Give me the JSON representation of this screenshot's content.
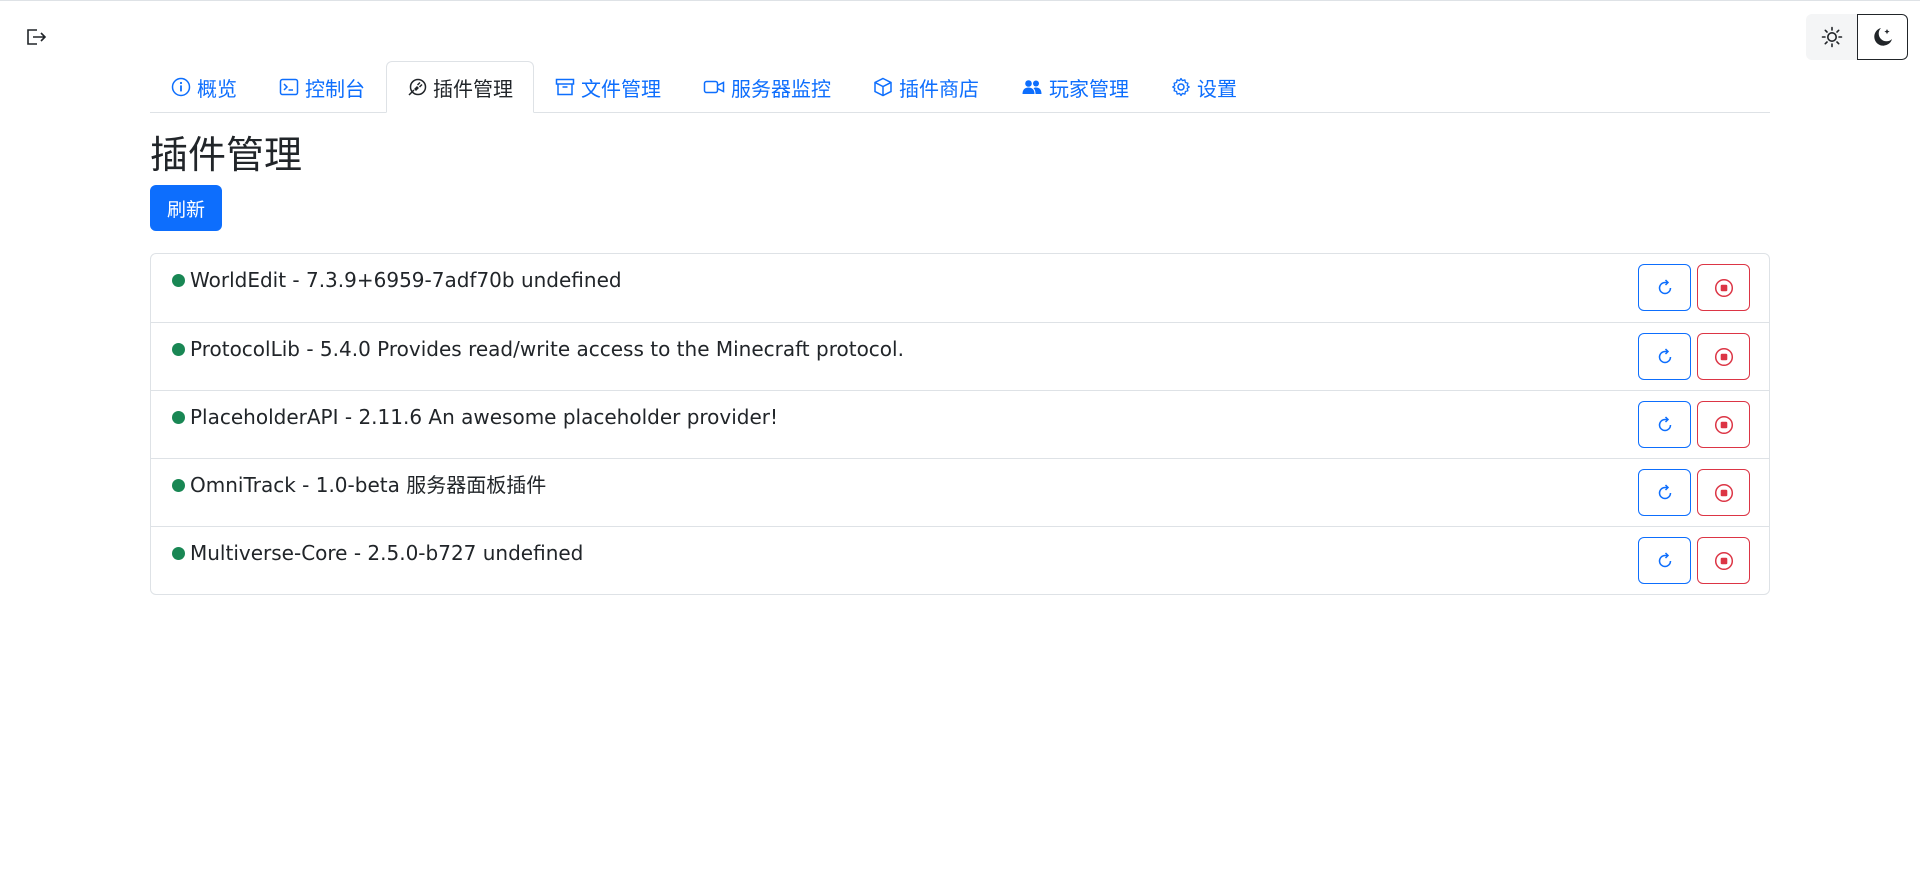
{
  "header": {
    "logout_icon": "logout-icon",
    "theme_light_icon": "sun-icon",
    "theme_dark_icon": "moon-icon"
  },
  "tabs": [
    {
      "label": "概览",
      "icon": "info-circle-icon"
    },
    {
      "label": "控制台",
      "icon": "terminal-icon"
    },
    {
      "label": "插件管理",
      "icon": "plugin-icon",
      "active": true
    },
    {
      "label": "文件管理",
      "icon": "archive-icon"
    },
    {
      "label": "服务器监控",
      "icon": "camera-icon"
    },
    {
      "label": "插件商店",
      "icon": "box-icon"
    },
    {
      "label": "玩家管理",
      "icon": "people-icon"
    },
    {
      "label": "设置",
      "icon": "gear-icon"
    }
  ],
  "main": {
    "title": "插件管理",
    "refresh_label": "刷新"
  },
  "plugins": [
    {
      "text": "WorldEdit - 7.3.9+6959-7adf70b undefined",
      "enabled": true
    },
    {
      "text": "ProtocolLib - 5.4.0 Provides read/write access to the Minecraft protocol.",
      "enabled": true
    },
    {
      "text": "PlaceholderAPI - 2.11.6 An awesome placeholder provider!",
      "enabled": true
    },
    {
      "text": "OmniTrack - 1.0-beta 服务器面板插件",
      "enabled": true
    },
    {
      "text": "Multiverse-Core - 2.5.0-b727 undefined",
      "enabled": true
    }
  ],
  "colors": {
    "primary": "#0d6efd",
    "danger": "#dc3545",
    "success": "#198754",
    "border": "#dee2e6"
  }
}
